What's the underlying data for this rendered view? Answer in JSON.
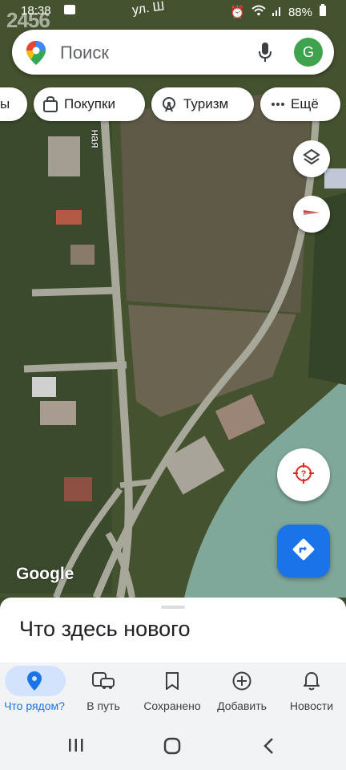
{
  "status_bar": {
    "time": "18:38",
    "watermark": "2456",
    "street_label": "ул. Ш",
    "battery": "88%"
  },
  "search": {
    "placeholder": "Поиск",
    "avatar_letter": "G"
  },
  "chips": [
    {
      "label": "ы",
      "icon": "partial-chip"
    },
    {
      "label": "Покупки",
      "icon": "shopping-bag-icon"
    },
    {
      "label": "Туризм",
      "icon": "ferris-wheel-icon"
    },
    {
      "label": "Ещё",
      "icon": "more-dots-icon"
    }
  ],
  "map": {
    "road_label": "ная",
    "attribution": "Google"
  },
  "sheet": {
    "title": "Что здесь нового"
  },
  "bottom_nav": [
    {
      "label": "Что рядом?",
      "icon": "location-pin-icon",
      "active": true
    },
    {
      "label": "В путь",
      "icon": "commute-icon",
      "active": false
    },
    {
      "label": "Сохранено",
      "icon": "bookmark-icon",
      "active": false
    },
    {
      "label": "Добавить",
      "icon": "add-circle-icon",
      "active": false
    },
    {
      "label": "Новости",
      "icon": "bell-icon",
      "active": false
    }
  ],
  "colors": {
    "accent": "#1a73e8",
    "active_pill": "#d3e3fd",
    "avatar": "#3fa34d",
    "river": "#7fa89a"
  }
}
